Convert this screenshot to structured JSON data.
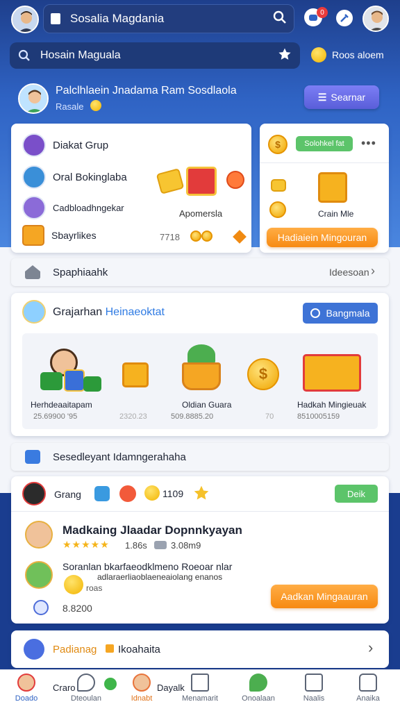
{
  "header": {
    "title": "Sosalia Magdania",
    "notification_badge": "0"
  },
  "search": {
    "value": "Hosain Maguala",
    "side_label": "Roos aloem"
  },
  "banner": {
    "title": "Palclhlaein Jnadama Ram Sosdlaola",
    "subtitle": "Rasale",
    "button_label": "Searnar"
  },
  "groups_card": {
    "items": [
      {
        "label": "Diakat Grup"
      },
      {
        "label": "Oral Bokinglaba"
      },
      {
        "label": "Cadbloadhngekar"
      },
      {
        "label": "Sbayrlikes"
      }
    ],
    "reward_label": "Apomersla",
    "count": "7718"
  },
  "reward_card": {
    "pill_label": "Solohkel fat",
    "item_label": "Crain Mle",
    "button_label": "Hadiaiein Mingouran"
  },
  "nav_row": {
    "label": "Spaphiaahk",
    "right_label": "Ideesoan"
  },
  "gifts_section": {
    "title_plain": "Grajarhan",
    "title_link": "Heinaeoktat",
    "button_label": "Bangmala",
    "gifts": [
      {
        "name": "Herhdeaaitapam",
        "value": "25.69900 '95"
      },
      {
        "name": "",
        "value": "2320.23"
      },
      {
        "name": "Oldian Guara",
        "value": "509.8885.20"
      },
      {
        "name": "",
        "value": "70"
      },
      {
        "name": "Hadkah Mingieuak",
        "value": "8510005159"
      }
    ]
  },
  "secondary_row": {
    "label": "Sesedleyant Idamngerahaha"
  },
  "group_card": {
    "header_label": "Grang",
    "count": "1109",
    "green_button": "Deik",
    "post_title": "Madkaing Jlaadar Dopnnkyayan",
    "rating_text": "1.86s",
    "rating_extra": "3.08m9",
    "desc_line1": "Soranlan bkarfaeodklmeno Roeoar nlar",
    "desc_line2": "adlaraerliaoblaeneaiolang enanos",
    "desc_line3": "roas",
    "price": "8.8200",
    "cta_label": "Aadkan Mingaauran"
  },
  "footer_row": {
    "label_left": "Padianag",
    "label_right": "Ikoahaita"
  },
  "tabbar": {
    "items": [
      {
        "label": "Craro",
        "sub": "Doado"
      },
      {
        "label": "Dteoulan"
      },
      {
        "label": "Dayalk",
        "sub": "Idnabt"
      },
      {
        "label": "Menamarit"
      },
      {
        "label": "Onoalaan"
      },
      {
        "label": "Naalis"
      },
      {
        "label": "Anaika"
      }
    ]
  },
  "colors": {
    "primary_blue": "#2f63c4",
    "accent_orange": "#f78a12",
    "accent_green": "#5cc46a",
    "link_blue": "#2f7be3"
  }
}
